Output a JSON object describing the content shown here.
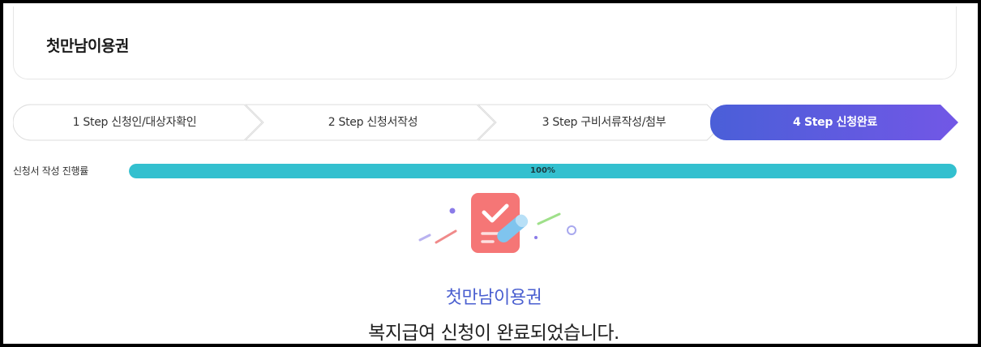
{
  "header": {
    "title": "첫만남이용권"
  },
  "steps": [
    {
      "label": "1 Step 신청인/대상자확인",
      "active": false
    },
    {
      "label": "2 Step 신청서작성",
      "active": false
    },
    {
      "label": "3 Step 구비서류작성/첨부",
      "active": false
    },
    {
      "label": "4 Step 신청완료",
      "active": true
    }
  ],
  "progress": {
    "label": "신청서 작성 진행률",
    "value": 100,
    "text": "100%"
  },
  "completion": {
    "title": "첫만남이용권",
    "message": "복지급여 신청이 완료되었습니다."
  },
  "colors": {
    "step_active_start": "#4a5fd8",
    "step_active_end": "#7257e6",
    "progress_fill": "#33c0cf",
    "completion_title": "#4a5fd0"
  }
}
